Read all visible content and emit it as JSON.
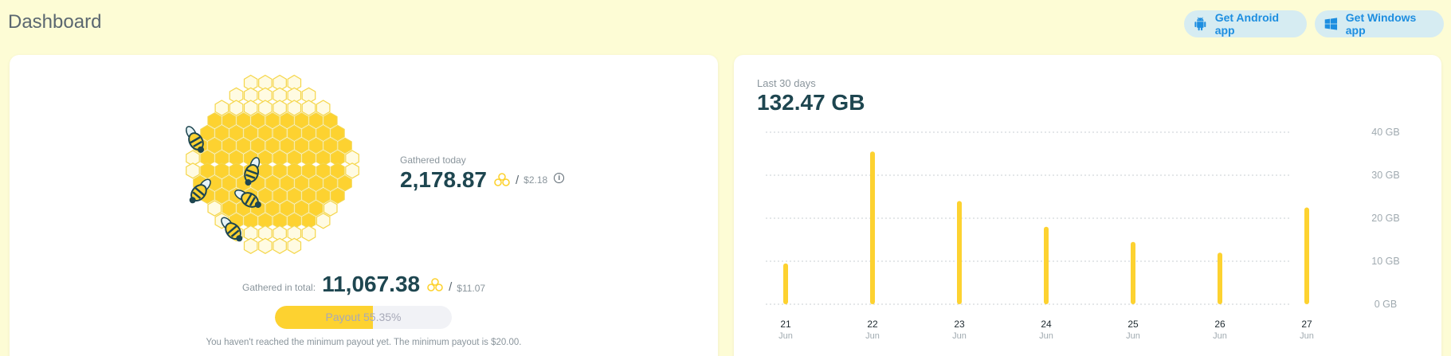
{
  "header": {
    "title": "Dashboard",
    "android_button": "Get Android app",
    "windows_button": "Get Windows app"
  },
  "earnings": {
    "today_label": "Gathered today",
    "today_value": "2,178.87",
    "today_usd": "$2.18",
    "total_label": "Gathered in total:",
    "total_value": "11,067.38",
    "total_usd": "$11.07",
    "slash": "/",
    "payout_text": "Payout 55.35%",
    "payout_percent": 55.35,
    "min_payout_note": "You haven't reached the minimum payout yet. The minimum payout is $20.00."
  },
  "traffic": {
    "period_label": "Last 30 days",
    "total": "132.47 GB"
  },
  "colors": {
    "accent_yellow": "#fdd230",
    "brand_dark": "#1e4650",
    "button_blue": "#1d8ee0",
    "button_bg": "#d6ecf2"
  },
  "icons": [
    "android-icon",
    "windows-icon",
    "honey-coin-icon",
    "info-icon",
    "honeycomb-illustration",
    "bee-icon"
  ],
  "chart_data": {
    "type": "bar",
    "categories": [
      "21",
      "22",
      "23",
      "24",
      "25",
      "26",
      "27"
    ],
    "category_sublabels": [
      "Jun",
      "Jun",
      "Jun",
      "Jun",
      "Jun",
      "Jun",
      "Jun"
    ],
    "values": [
      9.5,
      35.5,
      24,
      18,
      14.5,
      12,
      22.5
    ],
    "ylim": [
      0,
      40
    ],
    "yticks": [
      0,
      10,
      20,
      30,
      40
    ],
    "ytick_labels": [
      "0 GB",
      "10 GB",
      "20 GB",
      "30 GB",
      "40 GB"
    ],
    "grid": true,
    "bar_color": "#fdd230"
  }
}
